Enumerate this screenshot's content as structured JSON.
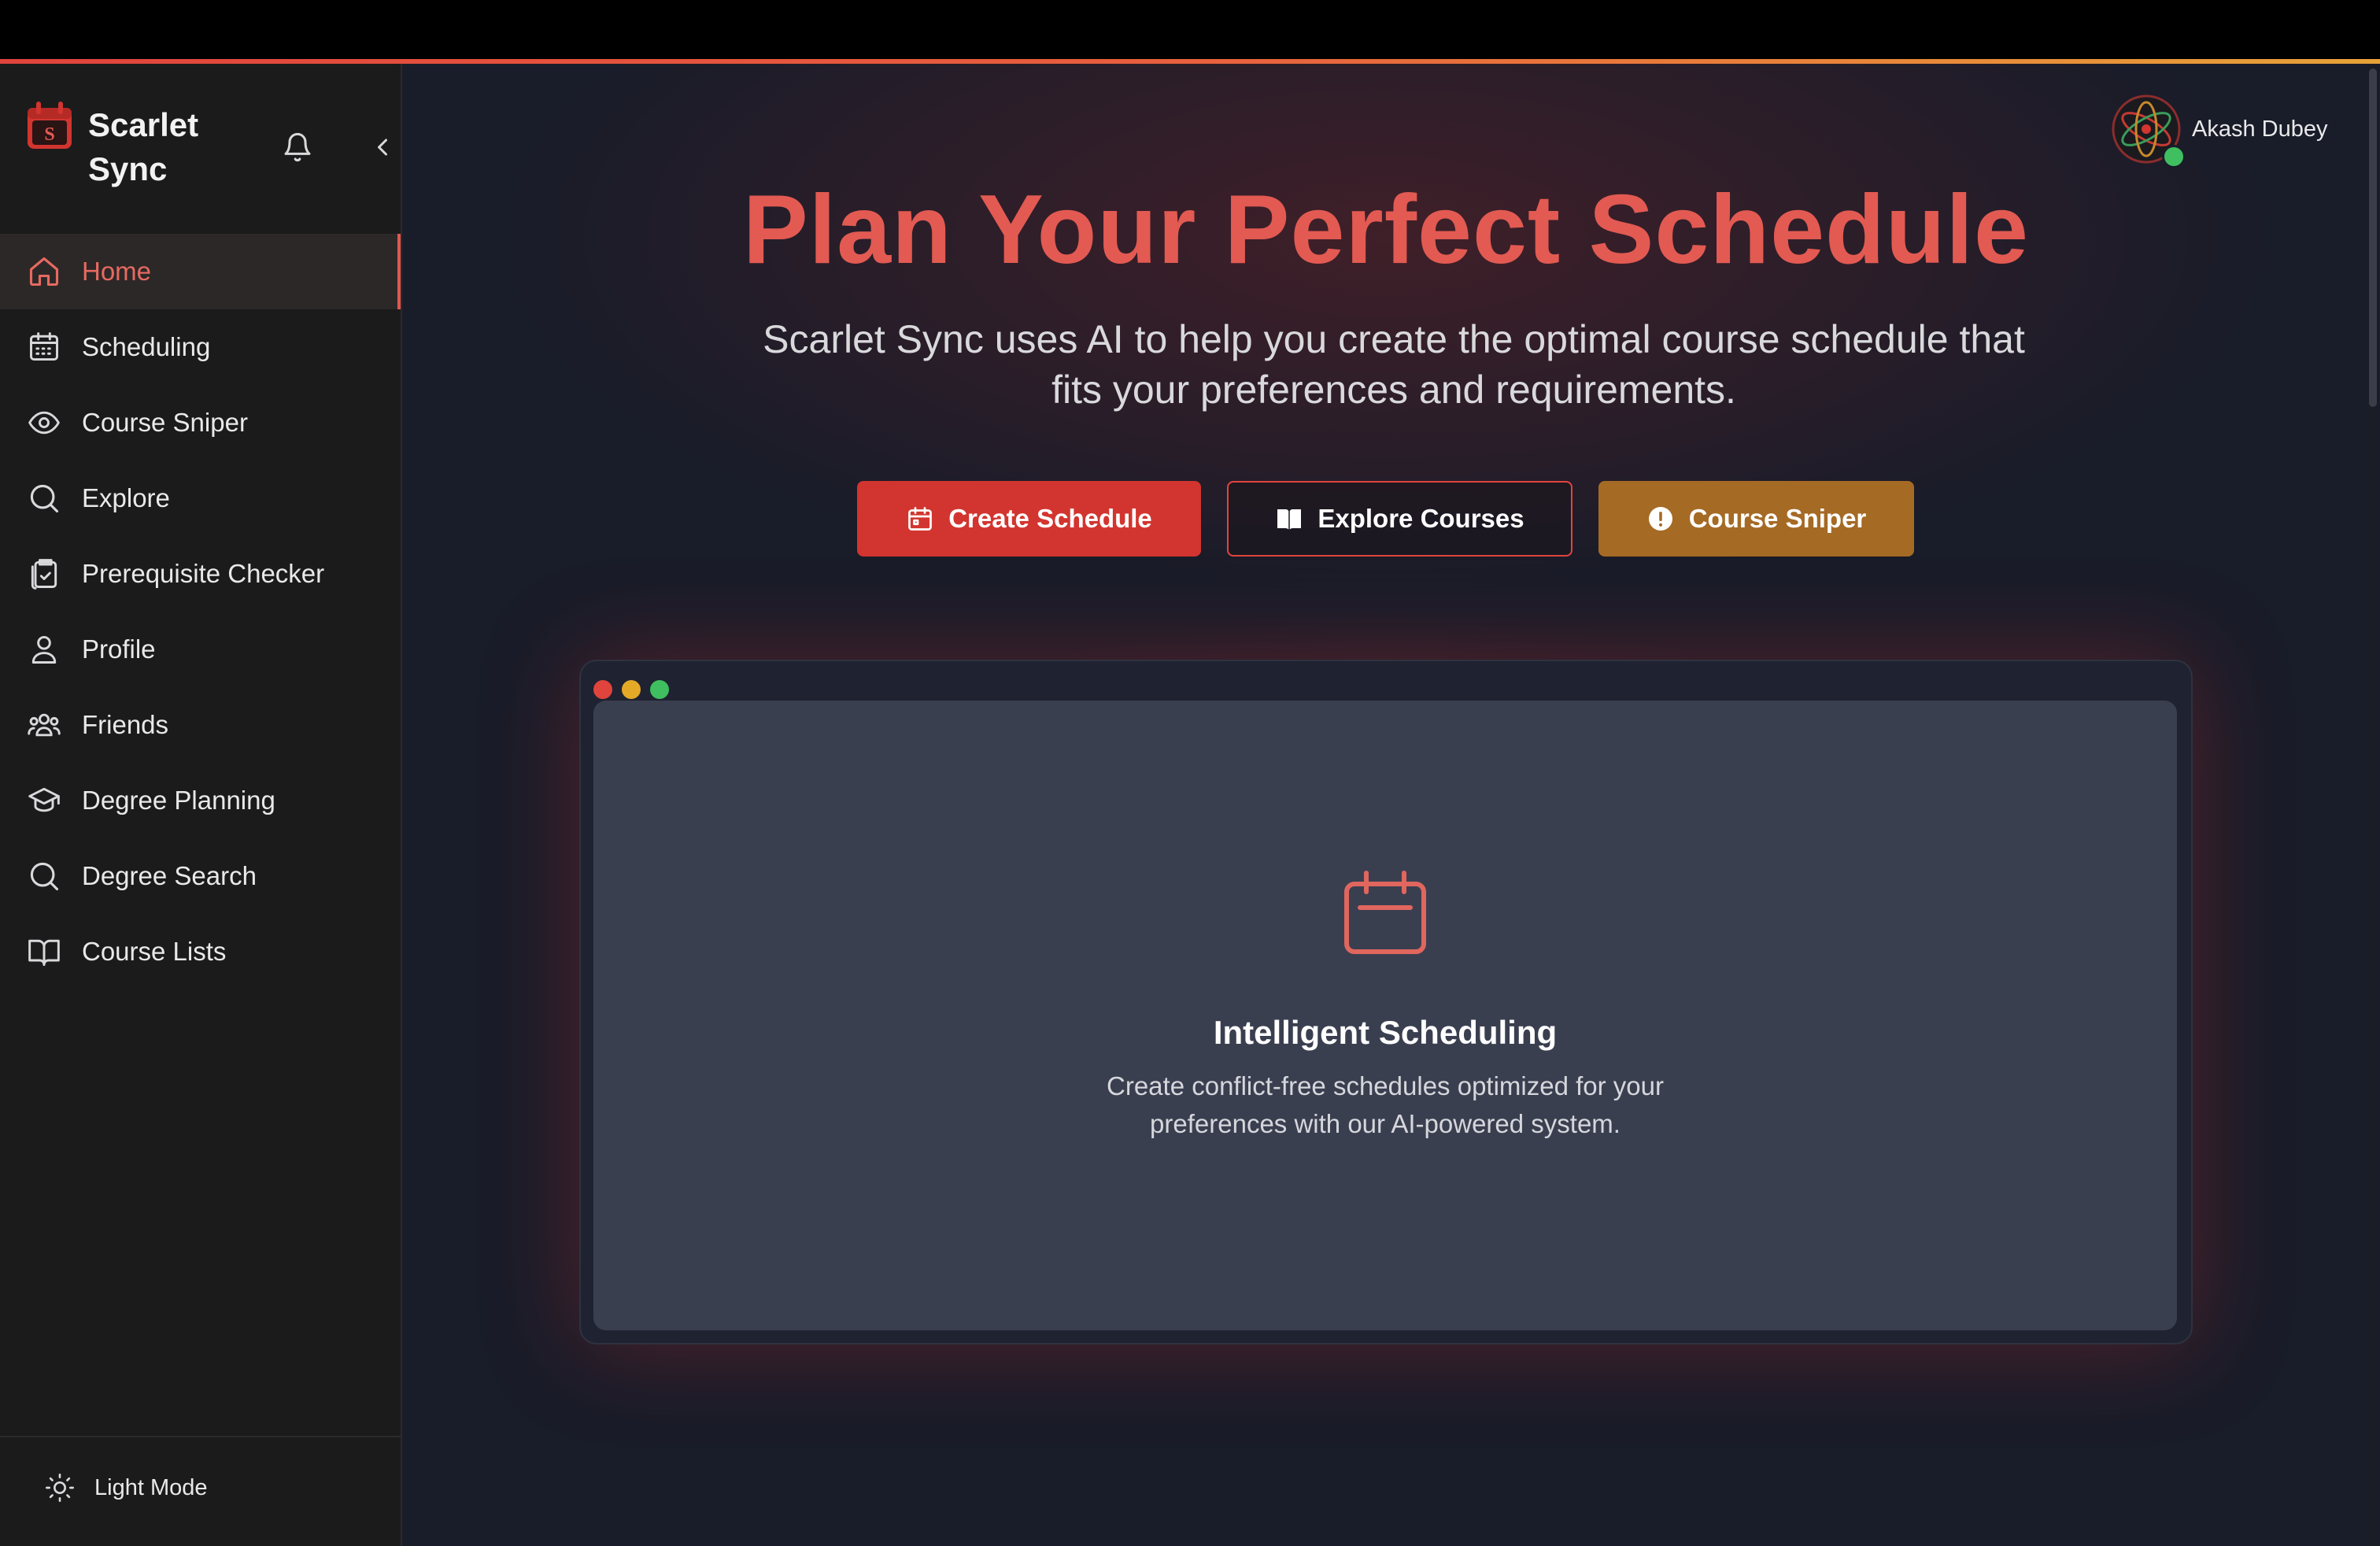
{
  "app": {
    "name": "Scarlet Sync",
    "logo_letter": "S",
    "accent": "#e25a52"
  },
  "sidebar": {
    "items": [
      {
        "label": "Home",
        "icon": "home-icon",
        "active": true
      },
      {
        "label": "Scheduling",
        "icon": "calendar-icon"
      },
      {
        "label": "Course Sniper",
        "icon": "eye-icon"
      },
      {
        "label": "Explore",
        "icon": "search-icon"
      },
      {
        "label": "Prerequisite Checker",
        "icon": "clipboard-check-icon"
      },
      {
        "label": "Profile",
        "icon": "user-icon"
      },
      {
        "label": "Friends",
        "icon": "users-icon"
      },
      {
        "label": "Degree Planning",
        "icon": "graduation-cap-icon"
      },
      {
        "label": "Degree Search",
        "icon": "search-icon"
      },
      {
        "label": "Course Lists",
        "icon": "book-open-icon"
      }
    ],
    "theme_toggle_label": "Light Mode"
  },
  "user": {
    "name": "Akash Dubey",
    "status_color": "#3fbf5f"
  },
  "hero": {
    "title": "Plan Your Perfect Schedule",
    "subtitle": "Scarlet Sync uses AI to help you create the optimal course schedule that fits your preferences and requirements."
  },
  "actions": {
    "create_label": "Create Schedule",
    "explore_label": "Explore Courses",
    "sniper_label": "Course Sniper"
  },
  "feature": {
    "title": "Intelligent Scheduling",
    "description": "Create conflict-free schedules optimized for your preferences with our AI-powered system."
  }
}
